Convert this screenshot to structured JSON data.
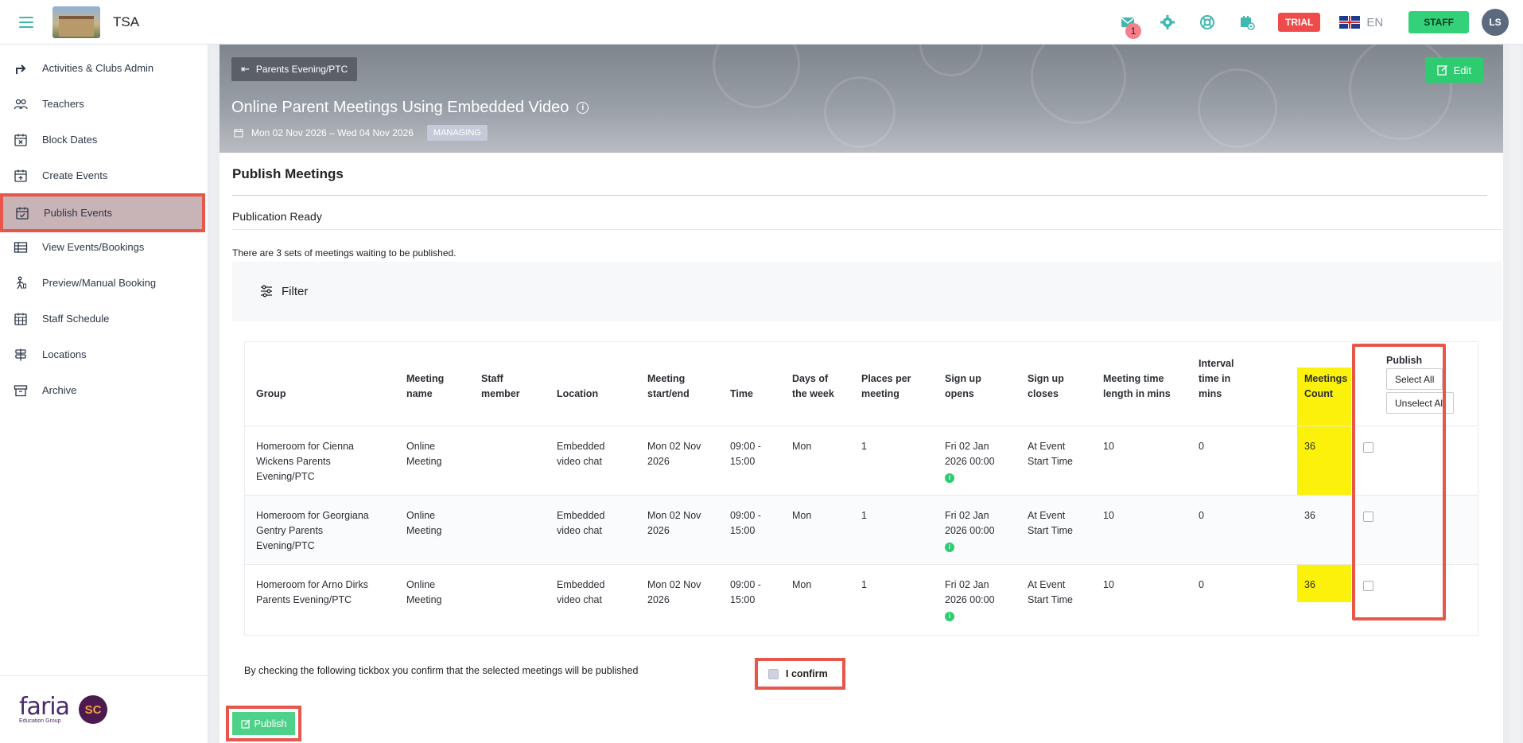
{
  "app": {
    "title": "TSA"
  },
  "topbar": {
    "mail_badge": "1",
    "trial_label": "TRIAL",
    "language": "EN",
    "staff_label": "STAFF",
    "avatar_initials": "LS",
    "accent_color": "#3fb8b0"
  },
  "sidebar": {
    "items": [
      {
        "label": "Activities & Clubs Admin",
        "icon": "arrow-up-icon"
      },
      {
        "label": "Teachers",
        "icon": "users-icon"
      },
      {
        "label": "Block Dates",
        "icon": "calendar-x-icon"
      },
      {
        "label": "Create Events",
        "icon": "calendar-plus-icon"
      },
      {
        "label": "Publish Events",
        "icon": "calendar-check-icon",
        "active": true
      },
      {
        "label": "View Events/Bookings",
        "icon": "table-icon"
      },
      {
        "label": "Preview/Manual Booking",
        "icon": "person-walking-icon"
      },
      {
        "label": "Staff Schedule",
        "icon": "calendar-grid-icon"
      },
      {
        "label": "Locations",
        "icon": "signpost-icon"
      },
      {
        "label": "Archive",
        "icon": "archive-icon"
      }
    ],
    "footer": {
      "brand": "faria",
      "brand_sub": "Education Group",
      "sc": "SC"
    }
  },
  "hero": {
    "back_label": "Parents Evening/PTC",
    "edit_label": "Edit",
    "title": "Online Parent Meetings Using Embedded Video",
    "dates": "Mon 02 Nov 2026 – Wed 04 Nov 2026",
    "status_badge": "MANAGING"
  },
  "main": {
    "section_title": "Publish Meetings",
    "subsection": "Publication Ready",
    "waiting_text": "There are 3 sets of meetings waiting to be published.",
    "filter_label": "Filter"
  },
  "table": {
    "headers": {
      "group": "Group",
      "meeting_name": [
        "Meeting",
        "name"
      ],
      "staff": [
        "Staff",
        "member"
      ],
      "location": "Location",
      "start_end": [
        "Meeting",
        "start/end"
      ],
      "time": "Time",
      "days": [
        "Days of",
        "the week"
      ],
      "places": [
        "Places per",
        "meeting"
      ],
      "opens": [
        "Sign up",
        "opens"
      ],
      "closes": [
        "Sign up",
        "closes"
      ],
      "length": [
        "Meeting time",
        "length in mins"
      ],
      "interval": [
        "Interval",
        "time in",
        "mins"
      ],
      "count": [
        "Meetings",
        "Count"
      ],
      "publish": "Publish"
    },
    "select_all": "Select All",
    "unselect_all": "Unselect All",
    "rows": [
      {
        "group": [
          "Homeroom for Cienna",
          "Wickens Parents",
          "Evening/PTC"
        ],
        "meeting_name": [
          "Online",
          "Meeting"
        ],
        "staff": "",
        "location": [
          "Embedded",
          "video chat"
        ],
        "start_end": [
          "Mon 02 Nov",
          "2026"
        ],
        "time": [
          "09:00 -",
          "15:00"
        ],
        "days": "Mon",
        "places": "1",
        "opens": [
          "Fri 02 Jan",
          "2026 00:00"
        ],
        "closes": [
          "At Event",
          "Start Time"
        ],
        "length": "10",
        "interval": "0",
        "count": "36"
      },
      {
        "group": [
          "Homeroom for Georgiana",
          "Gentry Parents",
          "Evening/PTC"
        ],
        "meeting_name": [
          "Online",
          "Meeting"
        ],
        "staff": "",
        "location": [
          "Embedded",
          "video chat"
        ],
        "start_end": [
          "Mon 02 Nov",
          "2026"
        ],
        "time": [
          "09:00 -",
          "15:00"
        ],
        "days": "Mon",
        "places": "1",
        "opens": [
          "Fri 02 Jan",
          "2026 00:00"
        ],
        "closes": [
          "At Event",
          "Start Time"
        ],
        "length": "10",
        "interval": "0",
        "count": "36"
      },
      {
        "group": [
          "Homeroom for Arno Dirks",
          "Parents Evening/PTC"
        ],
        "meeting_name": [
          "Online",
          "Meeting"
        ],
        "staff": "",
        "location": [
          "Embedded",
          "video chat"
        ],
        "start_end": [
          "Mon 02 Nov",
          "2026"
        ],
        "time": [
          "09:00 -",
          "15:00"
        ],
        "days": "Mon",
        "places": "1",
        "opens": [
          "Fri 02 Jan",
          "2026 00:00"
        ],
        "closes": [
          "At Event",
          "Start Time"
        ],
        "length": "10",
        "interval": "0",
        "count": "36"
      }
    ]
  },
  "confirm": {
    "text": "By checking the following tickbox you confirm that the selected meetings will be published",
    "checkbox_label": "I confirm"
  },
  "publish_label": "Publish",
  "highlight_color": "#e8554b",
  "count_highlight_color": "#fbf10a"
}
